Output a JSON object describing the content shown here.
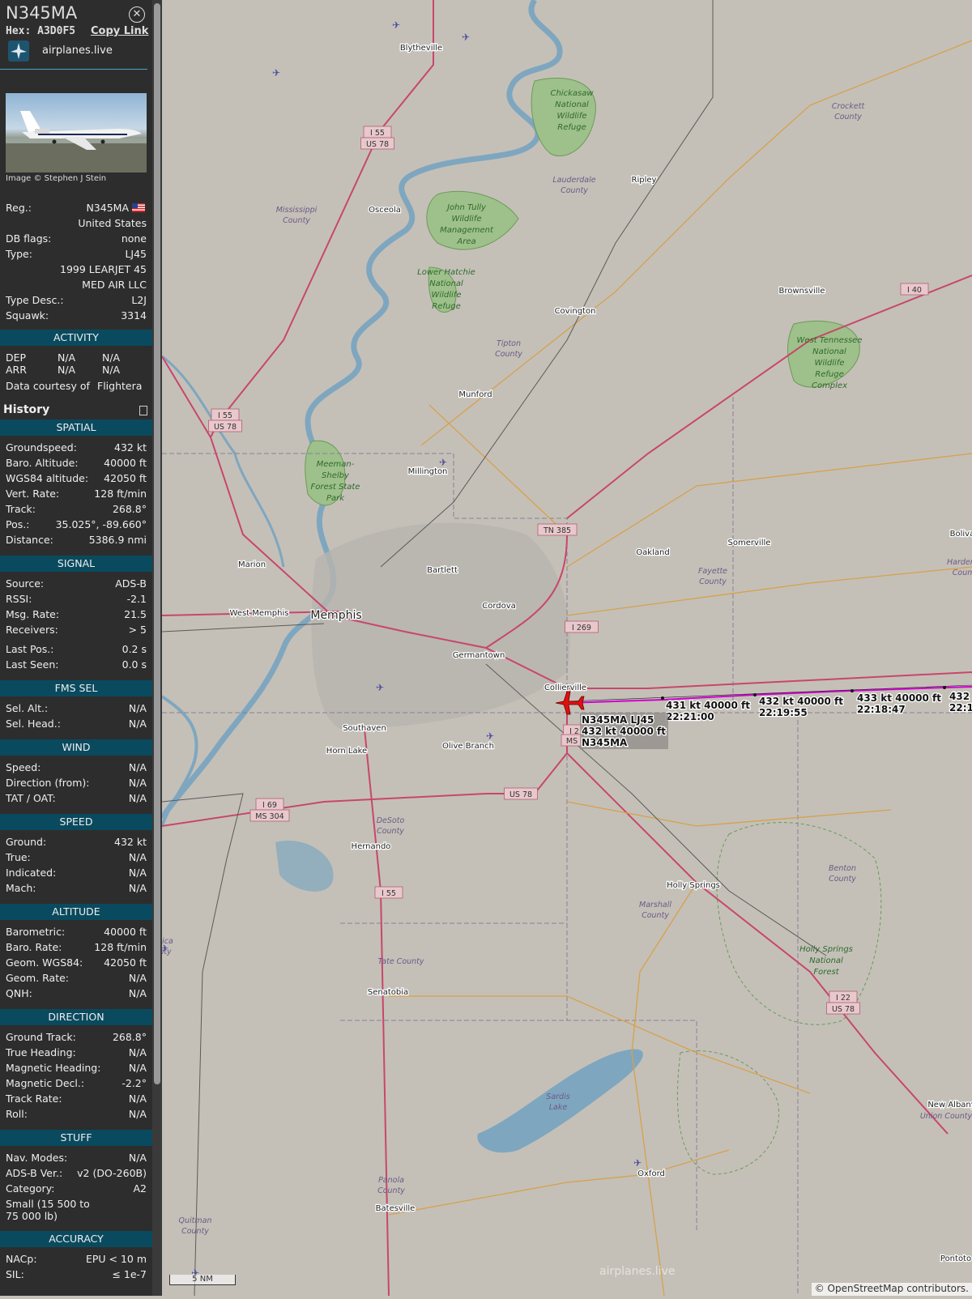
{
  "header": {
    "title": "N345MA",
    "hex": "Hex: A3D0F5",
    "copy_link": "Copy Link",
    "brand": "airplanes.live"
  },
  "photo": {
    "credit": "Image © Stephen J Stein"
  },
  "info": {
    "reg_label": "Reg.:",
    "reg": "N345MA",
    "country": "United States",
    "dbflags_label": "DB flags:",
    "dbflags": "none",
    "type_label": "Type:",
    "type": "LJ45",
    "type_full": "1999 LEARJET 45",
    "owner": "MED AIR LLC",
    "typedesc_label": "Type Desc.:",
    "typedesc": "L2J",
    "squawk_label": "Squawk:",
    "squawk": "3314"
  },
  "activity": {
    "title": "ACTIVITY",
    "dep": "DEP",
    "arr": "ARR",
    "na": "N/A",
    "courtesy": "Data courtesy of",
    "courtesy_brand": "Flightera"
  },
  "history": {
    "title": "History"
  },
  "sections": [
    {
      "title": "SPATIAL",
      "rows": [
        [
          "Groundspeed:",
          "432 kt"
        ],
        [
          "Baro. Altitude:",
          "40000 ft"
        ],
        [
          "WGS84 altitude:",
          "42050 ft"
        ],
        [
          "Vert. Rate:",
          "128 ft/min"
        ],
        [
          "Track:",
          "268.8°"
        ],
        [
          "Pos.:",
          "35.025°, -89.660°"
        ],
        [
          "Distance:",
          "5386.9 nmi"
        ]
      ]
    },
    {
      "title": "SIGNAL",
      "rows": [
        [
          "Source:",
          "ADS-B"
        ],
        [
          "RSSI:",
          "-2.1"
        ],
        [
          "Msg. Rate:",
          "21.5"
        ],
        [
          "Receivers:",
          "> 5"
        ],
        [
          "Last Pos.:",
          "0.2 s"
        ],
        [
          "Last Seen:",
          "0.0 s"
        ]
      ]
    },
    {
      "title": "FMS SEL",
      "rows": [
        [
          "Sel. Alt.:",
          "N/A"
        ],
        [
          "Sel. Head.:",
          "N/A"
        ]
      ]
    },
    {
      "title": "WIND",
      "rows": [
        [
          "Speed:",
          "N/A"
        ],
        [
          "Direction (from):",
          "N/A"
        ],
        [
          "TAT / OAT:",
          "N/A"
        ]
      ]
    },
    {
      "title": "SPEED",
      "rows": [
        [
          "Ground:",
          "432 kt"
        ],
        [
          "True:",
          "N/A"
        ],
        [
          "Indicated:",
          "N/A"
        ],
        [
          "Mach:",
          "N/A"
        ]
      ]
    },
    {
      "title": "ALTITUDE",
      "rows": [
        [
          "Barometric:",
          "40000 ft"
        ],
        [
          "Baro. Rate:",
          "128 ft/min"
        ],
        [
          "Geom. WGS84:",
          "42050 ft"
        ],
        [
          "Geom. Rate:",
          "N/A"
        ],
        [
          "QNH:",
          "N/A"
        ]
      ]
    },
    {
      "title": "DIRECTION",
      "rows": [
        [
          "Ground Track:",
          "268.8°"
        ],
        [
          "True Heading:",
          "N/A"
        ],
        [
          "Magnetic Heading:",
          "N/A"
        ],
        [
          "Magnetic Decl.:",
          "-2.2°"
        ],
        [
          "Track Rate:",
          "N/A"
        ],
        [
          "Roll:",
          "N/A"
        ]
      ]
    },
    {
      "title": "STUFF",
      "rows": [
        [
          "Nav. Modes:",
          "N/A"
        ],
        [
          "ADS-B Ver.:",
          "v2 (DO-260B)"
        ],
        [
          "Category:",
          "A2"
        ],
        [
          "Small (15 500 to 75 000 lb)",
          ""
        ]
      ]
    },
    {
      "title": "ACCURACY",
      "rows": [
        [
          "NACp:",
          "EPU < 10 m"
        ],
        [
          "SIL:",
          "≤ 1e-7"
        ]
      ]
    }
  ],
  "map": {
    "places": [
      [
        "Blytheville",
        520,
        62
      ],
      [
        "Osceola",
        475,
        262
      ],
      [
        "Ripley",
        795,
        225
      ],
      [
        "Covington",
        710,
        387
      ],
      [
        "Brownsville",
        990,
        362
      ],
      [
        "Munford",
        587,
        490
      ],
      [
        "Millington",
        528,
        585
      ],
      [
        "Somerville",
        925,
        673
      ],
      [
        "Oakland",
        806,
        685
      ],
      [
        "Marion",
        311,
        700
      ],
      [
        "Bartlett",
        546,
        707
      ],
      [
        "West Memphis",
        320,
        760
      ],
      [
        "Cordova",
        616,
        751
      ],
      [
        "Germantown",
        591,
        812
      ],
      [
        "Collierville",
        698,
        852
      ],
      [
        "Southaven",
        450,
        902
      ],
      [
        "Horn Lake",
        428,
        930
      ],
      [
        "Olive Branch",
        578,
        924
      ],
      [
        "Hernando",
        458,
        1048
      ],
      [
        "Holly Springs",
        856,
        1096
      ],
      [
        "Senatobia",
        479,
        1228
      ],
      [
        "Oxford",
        804,
        1452
      ],
      [
        "Batesville",
        488,
        1495
      ],
      [
        "New Albany",
        1175,
        1367
      ],
      [
        "Pontoto",
        1180,
        1557
      ],
      [
        "Bolivar",
        1190,
        662
      ]
    ],
    "areas": [
      [
        "Chickasaw",
        706,
        118
      ],
      [
        "National",
        706,
        132
      ],
      [
        "Wildlife",
        706,
        146
      ],
      [
        "Refuge",
        706,
        160
      ],
      [
        "John Tully",
        576,
        259
      ],
      [
        "Wildlife",
        576,
        273
      ],
      [
        "Management",
        576,
        287
      ],
      [
        "Area",
        576,
        301
      ],
      [
        "Lower Hatchie",
        551,
        339
      ],
      [
        "National",
        551,
        353
      ],
      [
        "Wildlife",
        551,
        367
      ],
      [
        "Refuge",
        551,
        381
      ],
      [
        "West Tennessee",
        1024,
        423
      ],
      [
        "National",
        1024,
        437
      ],
      [
        "Wildlife",
        1024,
        451
      ],
      [
        "Refuge",
        1024,
        465
      ],
      [
        "Complex",
        1024,
        479
      ],
      [
        "Meeman-",
        414,
        576
      ],
      [
        "Shelby",
        414,
        590
      ],
      [
        "Forest State",
        414,
        604
      ],
      [
        "Park",
        414,
        618
      ],
      [
        "Holly Springs",
        1020,
        1175
      ],
      [
        "National",
        1020,
        1189
      ],
      [
        "Forest",
        1020,
        1203
      ]
    ],
    "counties": [
      [
        "Crockett",
        1047,
        134
      ],
      [
        "County",
        1047,
        147
      ],
      [
        "Lauderdale",
        709,
        225
      ],
      [
        "County",
        709,
        238
      ],
      [
        "Mississippi",
        366,
        262
      ],
      [
        "County",
        366,
        275
      ],
      [
        "Tipton",
        628,
        427
      ],
      [
        "County",
        628,
        440
      ],
      [
        "Fayette",
        880,
        708
      ],
      [
        "County",
        880,
        721
      ],
      [
        "Hardem",
        1188,
        697
      ],
      [
        "Coun",
        1188,
        710
      ],
      [
        "DeSoto",
        482,
        1016
      ],
      [
        "County",
        482,
        1029
      ],
      [
        "Marshall",
        809,
        1120
      ],
      [
        "County",
        809,
        1133
      ],
      [
        "Benton",
        1040,
        1075
      ],
      [
        "County",
        1040,
        1088
      ],
      [
        "Tate County",
        495,
        1190
      ],
      [
        "Sardis",
        689,
        1357
      ],
      [
        "Lake",
        689,
        1370
      ],
      [
        "Panola",
        483,
        1460
      ],
      [
        "County",
        483,
        1473
      ],
      [
        "Quitman",
        241,
        1510
      ],
      [
        "County",
        241,
        1523
      ],
      [
        "Union County",
        1168,
        1381
      ],
      [
        "nica",
        204,
        1165
      ],
      [
        "nty",
        204,
        1178
      ]
    ],
    "shields": [
      [
        "I 55",
        466,
        167
      ],
      [
        "US 78",
        466,
        181
      ],
      [
        "I 55",
        278,
        516
      ],
      [
        "US 78",
        278,
        530
      ],
      [
        "TN 385",
        688,
        658
      ],
      [
        "I 269",
        718,
        778
      ],
      [
        "I 69",
        333,
        997
      ],
      [
        "MS 304",
        333,
        1011
      ],
      [
        "US 78",
        643,
        984
      ],
      [
        "I 55",
        480,
        1106
      ],
      [
        "I 22",
        1041,
        1235
      ],
      [
        "US 78",
        1041,
        1249
      ],
      [
        "I 40",
        1129,
        361
      ],
      [
        "I 2",
        709,
        906
      ],
      [
        "MS",
        706,
        918
      ]
    ],
    "track_labels": [
      [
        "431 kt  40000 ft",
        822,
        875
      ],
      [
        "22:21:00",
        822,
        889
      ],
      [
        "432 kt  40000 ft",
        937,
        870
      ],
      [
        "22:19:55",
        937,
        884
      ],
      [
        "433 kt  40000 ft",
        1058,
        866
      ],
      [
        "22:18:47",
        1058,
        880
      ],
      [
        "432",
        1172,
        864
      ],
      [
        "22:1",
        1172,
        878
      ]
    ],
    "aircraft_label": [
      "N345MA LJ45",
      "432 kt  40000 ft",
      "N345MA"
    ],
    "scale": "5 NM",
    "attribution": "© OpenStreetMap contributors.",
    "watermark": "airplanes.live",
    "colors": {
      "track": "#d000d0",
      "aircraft": "#e01010",
      "water": "#7fa6bf",
      "park": "#9ec08a"
    }
  }
}
